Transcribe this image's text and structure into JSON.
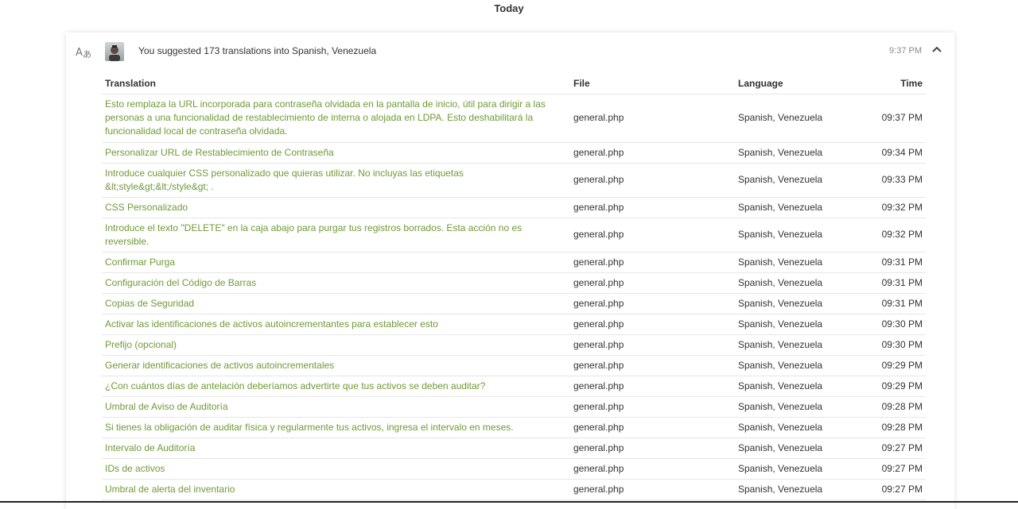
{
  "day_label": "Today",
  "activity": {
    "summary": "You suggested 173 translations into Spanish, Venezuela",
    "time": "9:37 PM",
    "icons": {
      "type": "translate-icon",
      "avatar": "user-avatar",
      "toggle": "chevron-up-icon"
    }
  },
  "table": {
    "headers": {
      "translation": "Translation",
      "file": "File",
      "language": "Language",
      "time": "Time"
    },
    "rows": [
      {
        "translation": "Esto remplaza la URL incorporada para contraseña olvidada en la pantalla de inicio, útil para dirigir a las personas a una funcionalidad de restablecimiento de interna o alojada en LDPA. Esto deshabilitará la funcionalidad local de contraseña olvidada.",
        "file": "general.php",
        "language": "Spanish, Venezuela",
        "time": "09:37 PM"
      },
      {
        "translation": "Personalizar URL de Restablecimiento de Contraseña",
        "file": "general.php",
        "language": "Spanish, Venezuela",
        "time": "09:34 PM"
      },
      {
        "translation": "Introduce cualquier CSS personalizado que quieras utilizar. No incluyas las etiquetas &lt;style&gt;&lt;/style&gt; .",
        "file": "general.php",
        "language": "Spanish, Venezuela",
        "time": "09:33 PM"
      },
      {
        "translation": "CSS Personalizado",
        "file": "general.php",
        "language": "Spanish, Venezuela",
        "time": "09:32 PM"
      },
      {
        "translation": "Introduce el texto \"DELETE\" en la caja abajo para purgar tus registros borrados. Esta acción no es reversible.",
        "file": "general.php",
        "language": "Spanish, Venezuela",
        "time": "09:32 PM"
      },
      {
        "translation": "Confirmar Purga",
        "file": "general.php",
        "language": "Spanish, Venezuela",
        "time": "09:31 PM"
      },
      {
        "translation": "Configuración del Código de Barras",
        "file": "general.php",
        "language": "Spanish, Venezuela",
        "time": "09:31 PM"
      },
      {
        "translation": "Copias de Seguridad",
        "file": "general.php",
        "language": "Spanish, Venezuela",
        "time": "09:31 PM"
      },
      {
        "translation": "Activar las identificaciones de activos autoincrementantes para establecer esto",
        "file": "general.php",
        "language": "Spanish, Venezuela",
        "time": "09:30 PM"
      },
      {
        "translation": "Prefijo (opcional)",
        "file": "general.php",
        "language": "Spanish, Venezuela",
        "time": "09:30 PM"
      },
      {
        "translation": "Generar identificaciones de activos autoincrementales",
        "file": "general.php",
        "language": "Spanish, Venezuela",
        "time": "09:29 PM"
      },
      {
        "translation": "¿Con cuántos días de antelación deberíamos advertirte que tus activos se deben auditar?",
        "file": "general.php",
        "language": "Spanish, Venezuela",
        "time": "09:29 PM"
      },
      {
        "translation": "Umbral de Aviso de Auditoría",
        "file": "general.php",
        "language": "Spanish, Venezuela",
        "time": "09:28 PM"
      },
      {
        "translation": "Si tienes la obligación de auditar física y regularmente tus activos, ingresa el intervalo en meses.",
        "file": "general.php",
        "language": "Spanish, Venezuela",
        "time": "09:28 PM"
      },
      {
        "translation": "Intervalo de Auditoría",
        "file": "general.php",
        "language": "Spanish, Venezuela",
        "time": "09:27 PM"
      },
      {
        "translation": "IDs de activos",
        "file": "general.php",
        "language": "Spanish, Venezuela",
        "time": "09:27 PM"
      },
      {
        "translation": "Umbral de alerta del inventario",
        "file": "general.php",
        "language": "Spanish, Venezuela",
        "time": "09:27 PM"
      }
    ]
  },
  "colors": {
    "link": "#6f9a37",
    "text": "#333333",
    "muted": "#8a8a8a",
    "border": "#e6e6e6"
  }
}
